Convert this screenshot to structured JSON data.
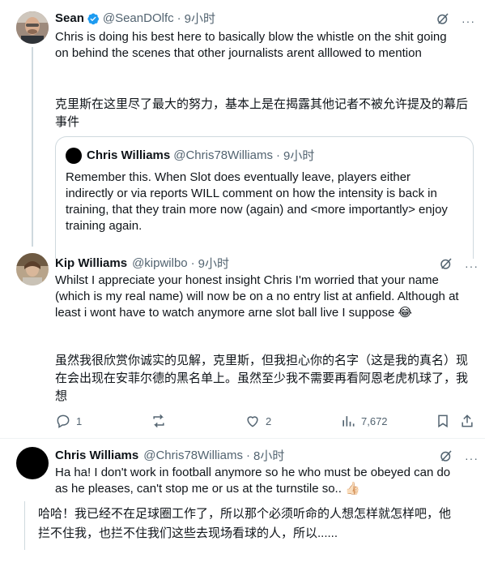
{
  "post1": {
    "name": "Sean",
    "handle": "@SeanDOlfc",
    "dot": "·",
    "time": "9小时",
    "text_lines": [
      "Chris is doing his best here to basically blow the whistle on the shit going",
      "on behind the scenes that other journalists arent alllowed to mention"
    ],
    "translation_lines": [
      "克里斯在这里尽了最大的努力，基本上是在揭露其他记者不被允许提及的幕后",
      "事件"
    ],
    "more": "···"
  },
  "quote": {
    "name": "Chris Williams",
    "handle": "@Chris78Williams",
    "dot": "·",
    "time": "9小时",
    "text_lines": [
      "Remember this. When Slot does eventually leave, players either",
      "indirectly or via reports WILL comment on how the intensity is back in",
      "training, that they train more now (again) and <more importantly> enjoy",
      "training again."
    ]
  },
  "post2": {
    "name": "Kip Williams",
    "handle": "@kipwilbo",
    "dot": "·",
    "time": "9小时",
    "text_lines": [
      "Whilst I appreciate your honest insight Chris I'm worried that your name",
      "(which is my real name) will now be on a no entry list at anfield. Although at",
      "least i wont have to watch anymore arne slot ball live I suppose 😂"
    ],
    "translation_lines": [
      "虽然我很欣赏你诚实的见解，克里斯，但我担心你的名字（这是我的真名）现",
      "在会出现在安菲尔德的黑名单上。虽然至少我不需要再看阿恩老虎机球了，我",
      "想"
    ],
    "more": "···",
    "actions": {
      "replies": "1",
      "retweets": "",
      "likes": "2",
      "views": "7,672"
    }
  },
  "post3": {
    "name": "Chris Williams",
    "handle": "@Chris78Williams",
    "dot": "·",
    "time": "8小时",
    "text_lines": [
      "Ha ha! I don't work in football anymore so he who must be obeyed can do",
      "as he pleases, can't stop me or us at the turnstile so.. 👍🏻"
    ],
    "translation_lines": [
      "哈哈！我已经不在足球圈工作了，所以那个必须听命的人想怎样就怎样吧，他",
      "拦不住我，也拦不住我们这些去现场看球的人，所以......"
    ],
    "more": "···"
  },
  "colors": {
    "text": "#0f1419",
    "muted": "#536471",
    "verified": "#1d9bf0",
    "border": "#cfd9de"
  }
}
